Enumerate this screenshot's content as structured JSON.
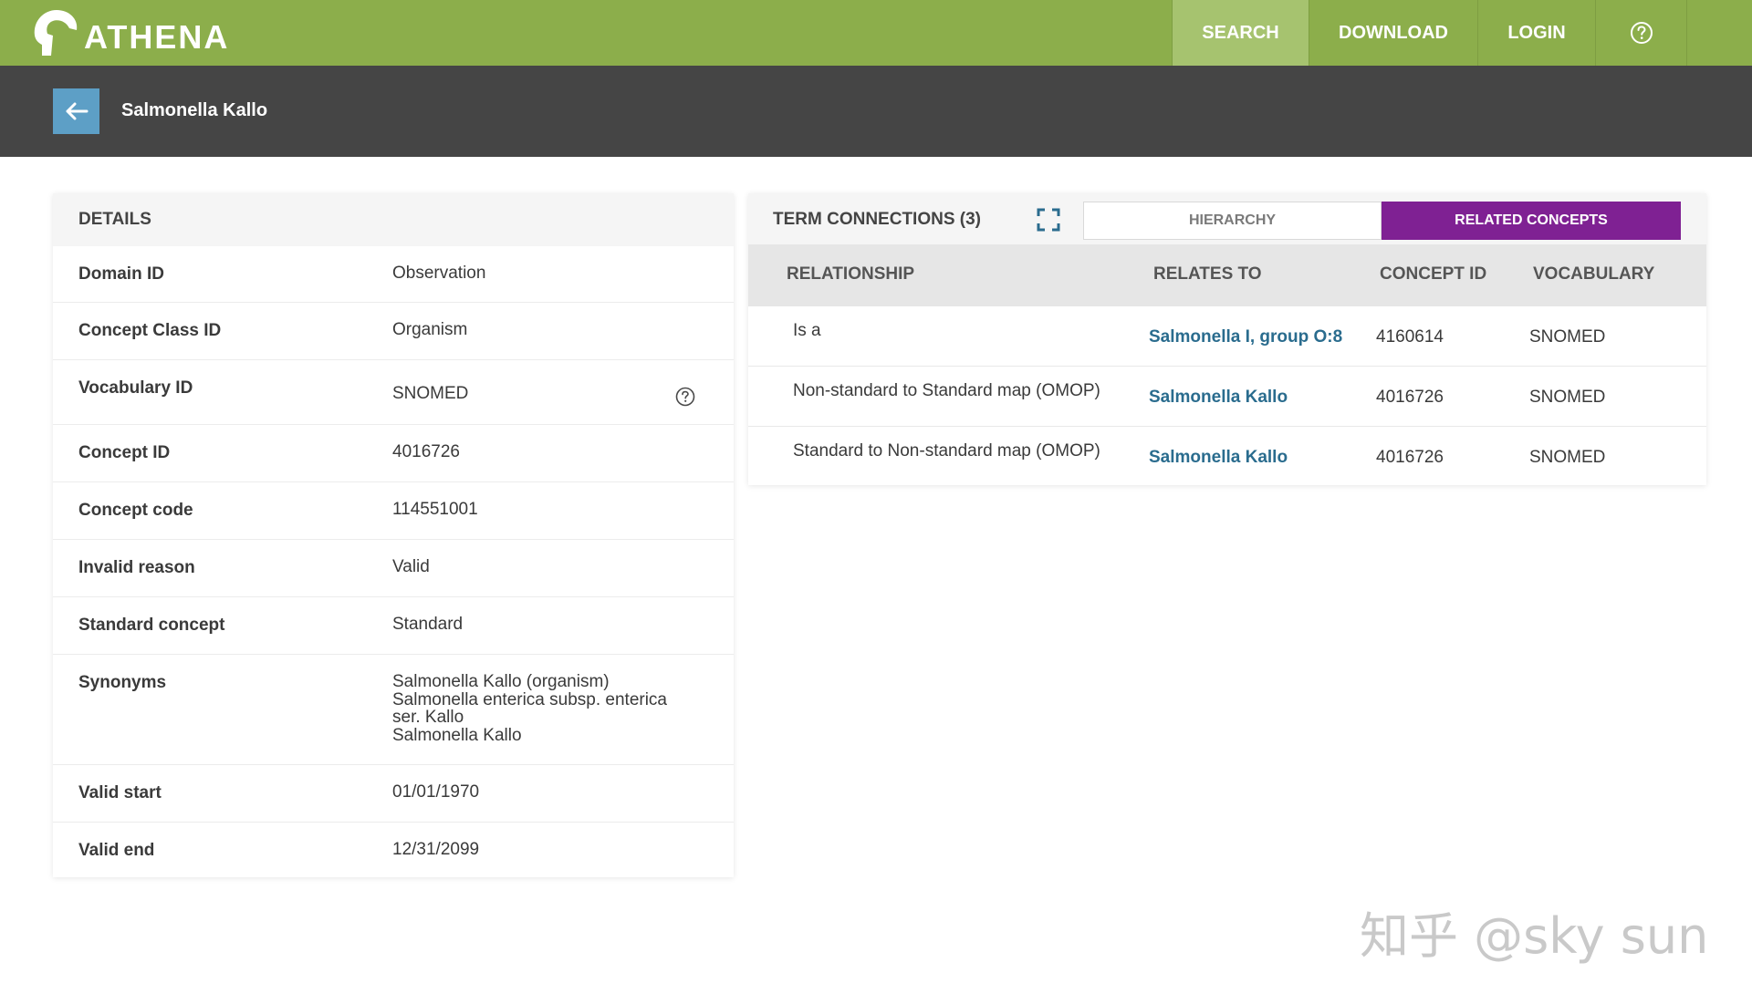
{
  "app": {
    "name": "ATHENA",
    "brand_color": "#8cae4b",
    "accent_color": "#7f2193",
    "link_color": "#2a6c8e"
  },
  "nav": {
    "items": [
      {
        "label": "SEARCH",
        "active": true
      },
      {
        "label": "DOWNLOAD",
        "active": false
      },
      {
        "label": "LOGIN",
        "active": false
      }
    ],
    "help_icon": "help-circle-icon"
  },
  "header": {
    "back_icon": "arrow-left-icon",
    "title": "Salmonella Kallo"
  },
  "details": {
    "heading": "DETAILS",
    "rows": [
      {
        "label": "Domain ID",
        "value": "Observation"
      },
      {
        "label": "Concept Class ID",
        "value": "Organism"
      },
      {
        "label": "Vocabulary ID",
        "value": "SNOMED",
        "icon": "help-circle-icon"
      },
      {
        "label": "Concept ID",
        "value": "4016726"
      },
      {
        "label": "Concept code",
        "value": "114551001"
      },
      {
        "label": "Invalid reason",
        "value": "Valid"
      },
      {
        "label": "Standard concept",
        "value": "Standard"
      },
      {
        "label": "Synonyms",
        "values": [
          "Salmonella Kallo (organism)",
          "Salmonella enterica subsp. enterica",
          "ser. Kallo",
          "Salmonella Kallo"
        ]
      },
      {
        "label": "Valid start",
        "value": "01/01/1970"
      },
      {
        "label": "Valid end",
        "value": "12/31/2099"
      }
    ]
  },
  "term_connections": {
    "title": "TERM CONNECTIONS (3)",
    "expand_icon": "fullscreen-expand-icon",
    "tabs": [
      {
        "label": "HIERARCHY",
        "active": false
      },
      {
        "label": "RELATED CONCEPTS",
        "active": true
      }
    ],
    "columns": [
      "RELATIONSHIP",
      "RELATES TO",
      "CONCEPT ID",
      "VOCABULARY"
    ],
    "rows": [
      {
        "relationship": "Is a",
        "relates_to": "Salmonella I, group O:8",
        "concept_id": "4160614",
        "vocabulary": "SNOMED"
      },
      {
        "relationship": "Non-standard to Standard map (OMOP)",
        "relates_to": "Salmonella Kallo",
        "concept_id": "4016726",
        "vocabulary": "SNOMED"
      },
      {
        "relationship": "Standard to Non-standard map (OMOP)",
        "relates_to": "Salmonella Kallo",
        "concept_id": "4016726",
        "vocabulary": "SNOMED"
      }
    ]
  },
  "watermark": {
    "text": "知乎 @sky sun"
  }
}
